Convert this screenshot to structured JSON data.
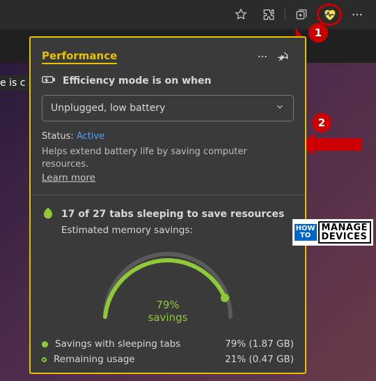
{
  "toolbar": {
    "icons": [
      "favorites",
      "extensions",
      "collections",
      "performance",
      "more"
    ]
  },
  "truncated": "e is c",
  "annotations": {
    "badge1": "1",
    "badge2": "2"
  },
  "panel": {
    "title": "Performance",
    "efficiency": {
      "label": "Efficiency mode is on when",
      "dropdown_value": "Unplugged, low battery"
    },
    "status": {
      "label": "Status:",
      "value": "Active"
    },
    "help_text": "Helps extend battery life by saving computer resources.",
    "learn_more": "Learn more",
    "sleeping": {
      "headline": "17 of 27 tabs sleeping to save resources",
      "estimated": "Estimated memory savings:"
    },
    "gauge": {
      "percent": "79%",
      "label": "savings"
    },
    "legend": [
      {
        "label": "Savings with sleeping tabs",
        "value": "79% (1.87 GB)"
      },
      {
        "label": "Remaining usage",
        "value": "21% (0.47 GB)"
      }
    ]
  },
  "chart_data": {
    "type": "pie",
    "title": "Estimated memory savings",
    "series": [
      {
        "name": "Savings with sleeping tabs",
        "value": 79,
        "size_gb": 1.87
      },
      {
        "name": "Remaining usage",
        "value": 21,
        "size_gb": 0.47
      }
    ],
    "display": "semi-gauge",
    "center_label": "79% savings",
    "color": "#8fc93a"
  },
  "watermark": {
    "how": "HOW",
    "to": "TO",
    "manage": "MANAGE",
    "devices": "DEVICES"
  }
}
